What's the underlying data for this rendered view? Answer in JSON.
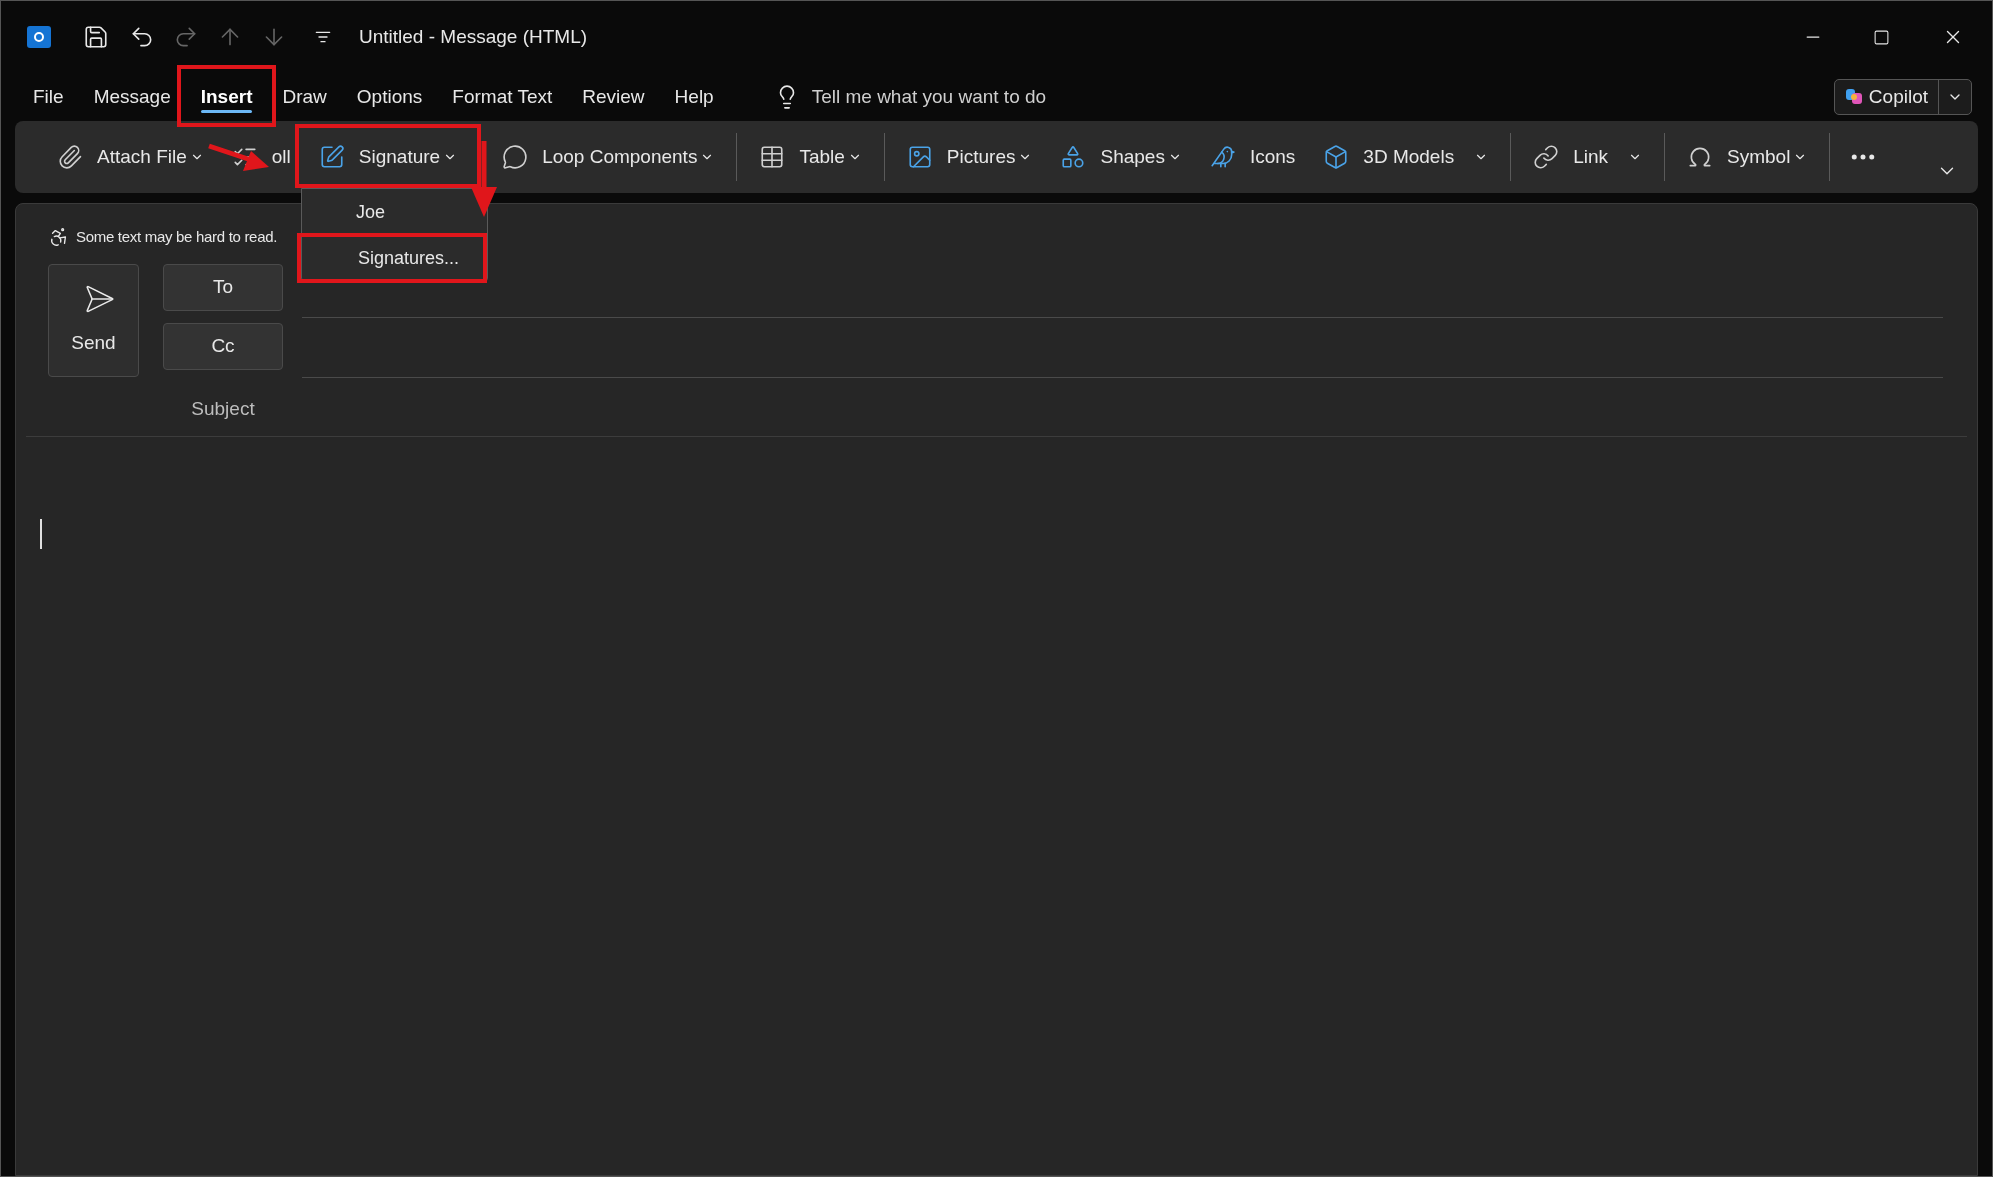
{
  "title_bar": {
    "title": "Untitled - Message (HTML)"
  },
  "menu_tabs": [
    {
      "label": "File",
      "selected": false,
      "highlighted": false
    },
    {
      "label": "Message",
      "selected": false,
      "highlighted": false
    },
    {
      "label": "Insert",
      "selected": true,
      "highlighted": true
    },
    {
      "label": "Draw",
      "selected": false,
      "highlighted": false
    },
    {
      "label": "Options",
      "selected": false,
      "highlighted": false
    },
    {
      "label": "Format Text",
      "selected": false,
      "highlighted": false
    },
    {
      "label": "Review",
      "selected": false,
      "highlighted": false
    },
    {
      "label": "Help",
      "selected": false,
      "highlighted": false
    }
  ],
  "tell_me": {
    "placeholder": "Tell me what you want to do"
  },
  "copilot": {
    "label": "Copilot"
  },
  "ribbon_groups": [
    [
      {
        "label": "Attach File",
        "kind": "dropdown",
        "highlighted": false
      },
      {
        "label": "oll",
        "kind": "button",
        "highlighted": false
      },
      {
        "label": "Signature",
        "kind": "dropdown",
        "highlighted": true
      }
    ],
    [
      {
        "label": "Loop Components",
        "kind": "dropdown",
        "highlighted": false
      }
    ],
    [
      {
        "label": "Table",
        "kind": "dropdown",
        "highlighted": false
      }
    ],
    [
      {
        "label": "Pictures",
        "kind": "dropdown",
        "highlighted": false
      },
      {
        "label": "Shapes",
        "kind": "dropdown",
        "highlighted": false
      },
      {
        "label": "Icons",
        "kind": "button",
        "highlighted": false
      },
      {
        "label": "3D Models",
        "kind": "split",
        "highlighted": false
      }
    ],
    [
      {
        "label": "Link",
        "kind": "split",
        "highlighted": false
      }
    ],
    [
      {
        "label": "Symbol",
        "kind": "dropdown",
        "highlighted": false
      }
    ]
  ],
  "signature_menu": {
    "items": [
      {
        "label": "Joe",
        "highlighted": false
      },
      {
        "label": "Signatures...",
        "highlighted": true
      }
    ]
  },
  "infobar": {
    "text": "Some text may be hard to read."
  },
  "compose": {
    "send": "Send",
    "to": "To",
    "cc": "Cc",
    "subject": "Subject"
  }
}
